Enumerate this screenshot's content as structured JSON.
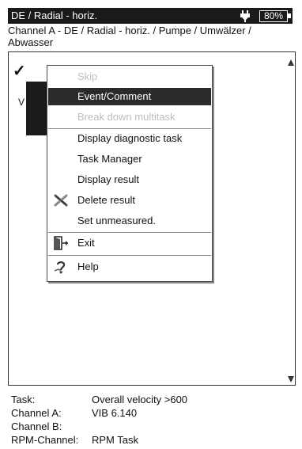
{
  "header": {
    "title": "DE / Radial - horiz.",
    "battery": "80%",
    "path": "Channel A - DE / Radial - horiz. / Pumpe / Umwälzer / Abwasser"
  },
  "background": {
    "letter": "V"
  },
  "menu": {
    "items": [
      {
        "label": "Skip",
        "state": "disabled"
      },
      {
        "label": "Event/Comment",
        "state": "selected"
      },
      {
        "label": "Break down multitask",
        "state": "disabled"
      },
      {
        "label": "Display diagnostic task",
        "state": "enabled"
      },
      {
        "label": "Task Manager",
        "state": "enabled"
      },
      {
        "label": "Display result",
        "state": "enabled"
      },
      {
        "label": "Delete result",
        "state": "enabled",
        "icon": "delete-icon"
      },
      {
        "label": "Set unmeasured.",
        "state": "enabled"
      },
      {
        "label": "Exit",
        "state": "enabled",
        "icon": "exit-door-icon"
      },
      {
        "label": "Help",
        "state": "enabled",
        "icon": "help-icon"
      }
    ]
  },
  "info": {
    "rows": [
      {
        "key": "Task:",
        "value": "Overall velocity >600"
      },
      {
        "key": "Channel A:",
        "value": "VIB 6.140"
      },
      {
        "key": "Channel B:",
        "value": ""
      },
      {
        "key": "RPM-Channel:",
        "value": "RPM Task"
      }
    ]
  },
  "colors": {
    "titlebar": "#1a1a1a",
    "selected": "#2b2b2b",
    "disabled": "#bdbdbd"
  }
}
